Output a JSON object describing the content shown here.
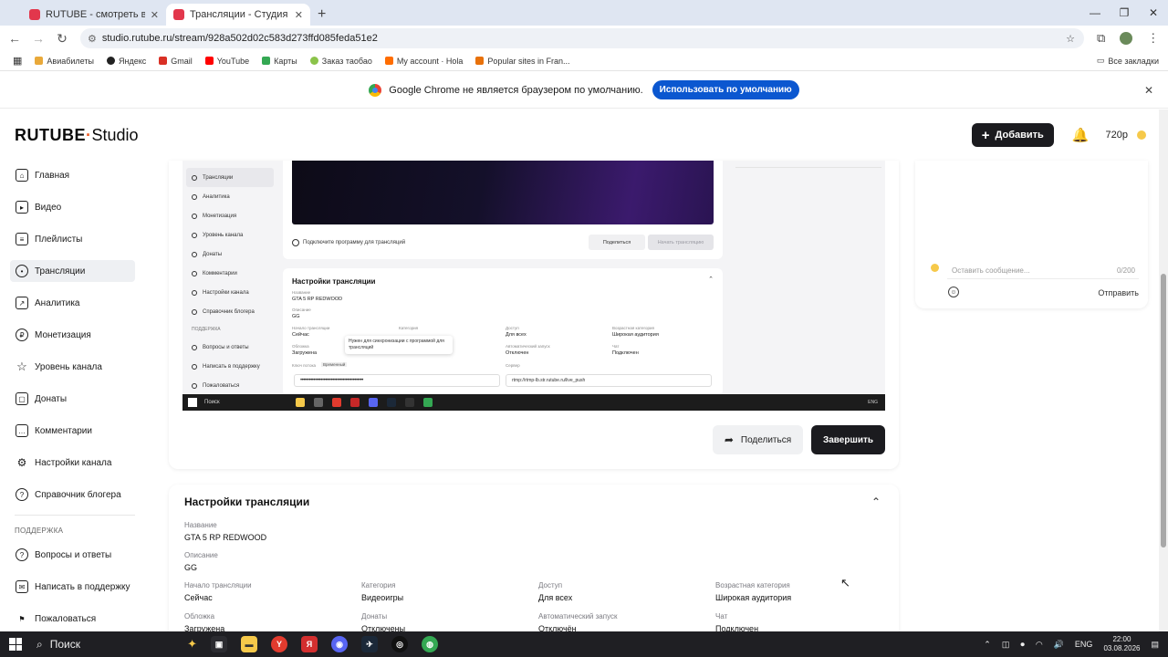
{
  "browser": {
    "tabs": [
      {
        "title": "RUTUBE - смотреть видео он..."
      },
      {
        "title": "Трансляции - Студия RUTUBE"
      }
    ],
    "url": "studio.rutube.ru/stream/928a502d02c583d273ffd085feda51e2",
    "bookmarks": [
      "Авиабилеты",
      "Яндекс",
      "Gmail",
      "YouTube",
      "Карты",
      "Заказ таобао",
      "My account · Hola",
      "Popular sites in Fran..."
    ],
    "all_bookmarks": "Все закладки",
    "infobar": {
      "text": "Google Chrome не является браузером по умолчанию.",
      "button": "Использовать по умолчанию"
    }
  },
  "header": {
    "logo_main": "RUTUBE",
    "logo_studio": "Studio",
    "add_label": "Добавить",
    "quality": "720p"
  },
  "sidebar": {
    "items": [
      {
        "label": "Главная",
        "icon": "home-icon"
      },
      {
        "label": "Видео",
        "icon": "video-icon"
      },
      {
        "label": "Плейлисты",
        "icon": "playlist-icon"
      },
      {
        "label": "Трансляции",
        "icon": "stream-icon"
      },
      {
        "label": "Аналитика",
        "icon": "analytics-icon"
      },
      {
        "label": "Монетизация",
        "icon": "money-icon"
      },
      {
        "label": "Уровень канала",
        "icon": "star-icon"
      },
      {
        "label": "Донаты",
        "icon": "donate-icon"
      },
      {
        "label": "Комментарии",
        "icon": "comment-icon"
      },
      {
        "label": "Настройки канала",
        "icon": "gear-icon"
      },
      {
        "label": "Справочник блогера",
        "icon": "help-icon"
      }
    ],
    "support_heading": "ПОДДЕРЖКА",
    "support_items": [
      {
        "label": "Вопросы и ответы"
      },
      {
        "label": "Написать в поддержку"
      },
      {
        "label": "Пожаловаться"
      }
    ]
  },
  "preview": {
    "mini": {
      "nav": [
        "Трансляции",
        "Аналитика",
        "Монетизация",
        "Уровень канала",
        "Донаты",
        "Комментарии",
        "Настройки канала",
        "Справочник блогера"
      ],
      "support_heading": "ПОДДЕРЖКА",
      "support": [
        "Вопросы и ответы",
        "Написать в поддержку",
        "Пожаловаться"
      ],
      "connect_text": "Подключите программу для трансляций",
      "share": "Поделиться",
      "start": "Начать трансляцию",
      "settings_title": "Настройки трансляции",
      "name_label": "Название",
      "name_value": "GTA 5 RP REDWOOD",
      "desc_label": "Описание",
      "desc_value": "GG",
      "start_label": "Начало трансляции",
      "start_value": "Сейчас",
      "category_label": "Категория",
      "access_label": "Доступ",
      "access_value": "Для всех",
      "age_label": "Возрастная категория",
      "age_value": "Широкая аудитория",
      "cover_label": "Обложка",
      "cover_value": "Загружена",
      "autostart_label": "Автоматический запуск",
      "autostart_value": "Отключен",
      "chat_label": "Чат",
      "chat_value": "Подключен",
      "key_label": "Ключ потока",
      "key_badge": "Временный",
      "server_label": "Сервер",
      "tooltip": "Нужен для синхронизации с программой для трансляций",
      "key_masked": "•••••••••••••••••••••••••••••••••••••••••••",
      "server_value": "rtmp://rtmp-lb.str.rutube.ru/live_push",
      "taskbar_search": "Поиск",
      "tray": "ENG"
    },
    "share_label": "Поделиться",
    "end_label": "Завершить"
  },
  "settings": {
    "title": "Настройки трансляции",
    "name_label": "Название",
    "name_value": "GTA 5 RP REDWOOD",
    "desc_label": "Описание",
    "desc_value": "GG",
    "start_label": "Начало трансляции",
    "start_value": "Сейчас",
    "category_label": "Категория",
    "category_value": "Видеоигры",
    "access_label": "Доступ",
    "access_value": "Для всех",
    "age_label": "Возрастная категория",
    "age_value": "Широкая аудитория",
    "cover_label": "Обложка",
    "cover_value": "Загружена",
    "donate_label": "Донаты",
    "donate_value": "Отключены",
    "autostart_label": "Автоматический запуск",
    "autostart_value": "Отключён",
    "chat_label": "Чат",
    "chat_value": "Подключен"
  },
  "chat": {
    "placeholder": "Оставить сообщение...",
    "counter": "0/200",
    "send": "Отправить"
  },
  "taskbar": {
    "search": "Поиск",
    "lang": "ENG",
    "time": "22:00",
    "date": "03.08.2026"
  }
}
